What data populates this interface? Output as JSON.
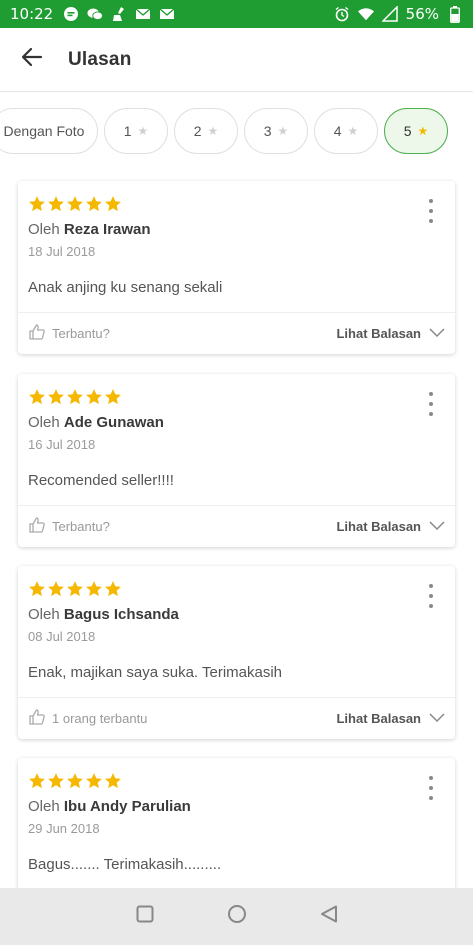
{
  "status_bar": {
    "time": "10:22",
    "battery": "56%",
    "left_icons": [
      "chat-icon",
      "wechat-icon",
      "cleaner-icon",
      "mail-icon",
      "mail-icon"
    ],
    "right_icons": [
      "alarm-icon",
      "wifi-icon",
      "signal-icon",
      "battery-icon"
    ]
  },
  "header": {
    "title": "Ulasan",
    "back_icon": "arrow-left-icon"
  },
  "filters": [
    {
      "label": "Dengan Foto",
      "active": false
    },
    {
      "label": "1",
      "star": true,
      "active": false
    },
    {
      "label": "2",
      "star": true,
      "active": false
    },
    {
      "label": "3",
      "star": true,
      "active": false
    },
    {
      "label": "4",
      "star": true,
      "active": false
    },
    {
      "label": "5",
      "star": true,
      "active": true
    }
  ],
  "reviews": [
    {
      "rating": 5,
      "by": "Oleh",
      "author": "Reza Irawan",
      "date": "18 Jul 2018",
      "text": "Anak anjing ku senang sekali",
      "helpful": "Terbantu?",
      "reply": "Lihat Balasan"
    },
    {
      "rating": 5,
      "by": "Oleh",
      "author": "Ade Gunawan",
      "date": "16 Jul 2018",
      "text": "Recomended seller!!!!",
      "helpful": "Terbantu?",
      "reply": "Lihat Balasan"
    },
    {
      "rating": 5,
      "by": "Oleh",
      "author": "Bagus Ichsanda",
      "date": "08 Jul 2018",
      "text": "Enak, majikan saya suka. Terimakasih",
      "helpful": "1 orang terbantu",
      "reply": "Lihat Balasan"
    },
    {
      "rating": 5,
      "by": "Oleh",
      "author": "Ibu Andy Parulian",
      "date": "29 Jun 2018",
      "text": "Bagus....... Terimakasih.........",
      "helpful": "",
      "reply": ""
    }
  ],
  "colors": {
    "status_bar": "#1f9c32",
    "star": "#f5b800",
    "active_chip_bg": "#eef8ea",
    "active_chip_border": "#4caf50"
  },
  "nav_bar": [
    "square-recents-icon",
    "circle-home-icon",
    "triangle-back-icon"
  ]
}
